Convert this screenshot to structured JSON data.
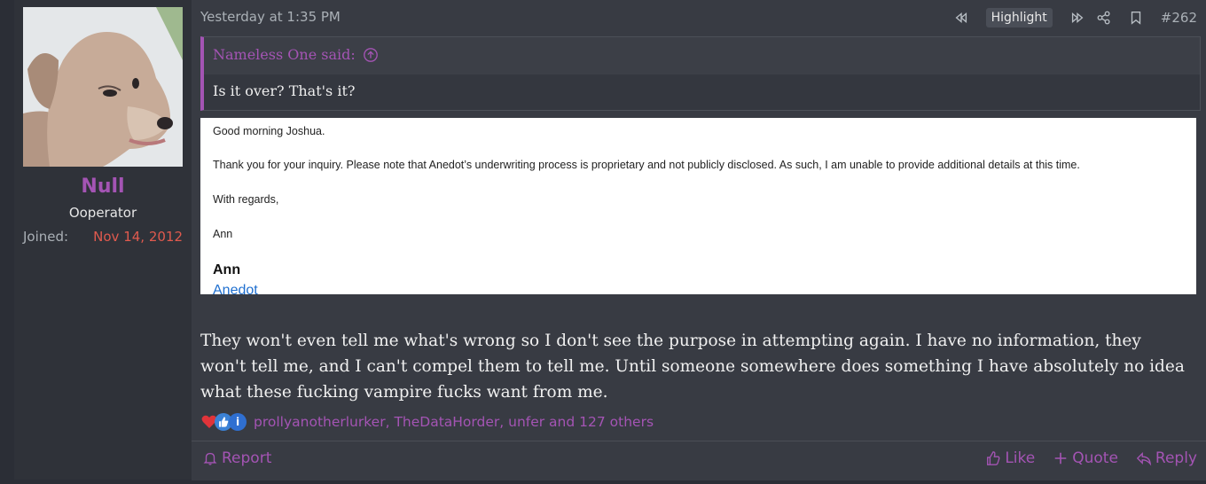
{
  "user": {
    "name": "Null",
    "title": "Ooperator",
    "joined_label": "Joined:",
    "joined_value": "Nov 14, 2012"
  },
  "meta": {
    "date": "Yesterday at 1:35 PM",
    "highlight_label": "Highlight",
    "post_number": "#262"
  },
  "quote": {
    "author": "Nameless One said:",
    "text": "Is it over? That's it?"
  },
  "email": {
    "greeting": "Good morning Joshua.",
    "paragraph": "Thank you for your inquiry. Please note that Anedot’s underwriting process is proprietary and not publicly disclosed. As such, I am unable to provide additional details at this time.",
    "closing": "With regards,",
    "signature_short": "Ann",
    "signature_name": "Ann",
    "signature_company": "Anedot"
  },
  "post": {
    "text": "They won't even tell me what's wrong so I don't see the purpose in attempting again. I have no information, they won't tell me, and I can't compel them to tell me. Until someone somewhere does something I have absolutely no idea what these fucking vampire fucks want from me."
  },
  "reactions": {
    "icons": [
      "heart-icon",
      "thumbs-up-icon",
      "info-icon"
    ],
    "text": "prollyanotherlurker, TheDataHorder, unfer and 127 others"
  },
  "footer": {
    "report": "Report",
    "like": "Like",
    "quote": "Quote",
    "reply": "Reply"
  },
  "colors": {
    "accent": "#a454b4",
    "joined_date": "#e05a4e",
    "background": "#383b43",
    "sidebar": "#2f3239"
  }
}
